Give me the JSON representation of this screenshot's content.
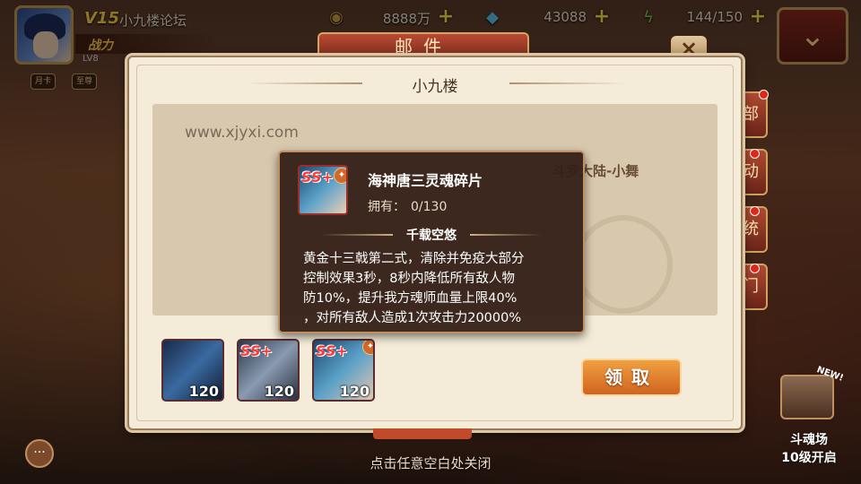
{
  "hud": {
    "vip": "V15",
    "player_name": "小九楼论坛",
    "power_label": "战力",
    "level": "LV8",
    "tags": [
      "月卡",
      "至尊"
    ],
    "gold": "8888万",
    "diamond": "43088",
    "stamina": "144/150",
    "plus": "+",
    "gold_icon": "coins-icon",
    "diamond_icon": "diamond-icon",
    "stamina_icon": "lightning-icon"
  },
  "mail": {
    "tab_title": "邮件",
    "close": "×",
    "dialog_title": "小九楼",
    "website": "www.xjyxi.com",
    "sender": "斗罗大陆-小舞",
    "claim_label": "领取"
  },
  "side_buttons": [
    "部",
    "动",
    "统",
    "门"
  ],
  "attachments": [
    {
      "name": "weapon-spear",
      "count": "120",
      "ss": false
    },
    {
      "name": "ss-soul-tool",
      "count": "120",
      "ss": true,
      "badge": "SS+"
    },
    {
      "name": "ss-character-fragment",
      "count": "120",
      "ss": true,
      "badge": "SS+"
    }
  ],
  "tooltip": {
    "badge": "SS+",
    "item_name": "海神唐三灵魂碎片",
    "own_label": "拥有：",
    "own_value": "0/130",
    "skill_name": "千载空悠",
    "desc_lines": [
      "黄金十三戟第二式，清除并免疫大部分",
      "控制效果3秒，8秒内降低所有敌人物",
      "防10%，提升我方魂师血量上限40%",
      "，对所有敌人造成1次攻击力20000%"
    ]
  },
  "bottom": {
    "hint": "点击任意空白处关闭",
    "chat": "···",
    "arena_new": "NEW!",
    "arena_title": "斗魂场",
    "arena_unlock": "10级开启"
  },
  "colors": {
    "accent_gold": "#ffd54a",
    "claim_orange": "#e07a2a",
    "ss_red": "#ff3838"
  }
}
